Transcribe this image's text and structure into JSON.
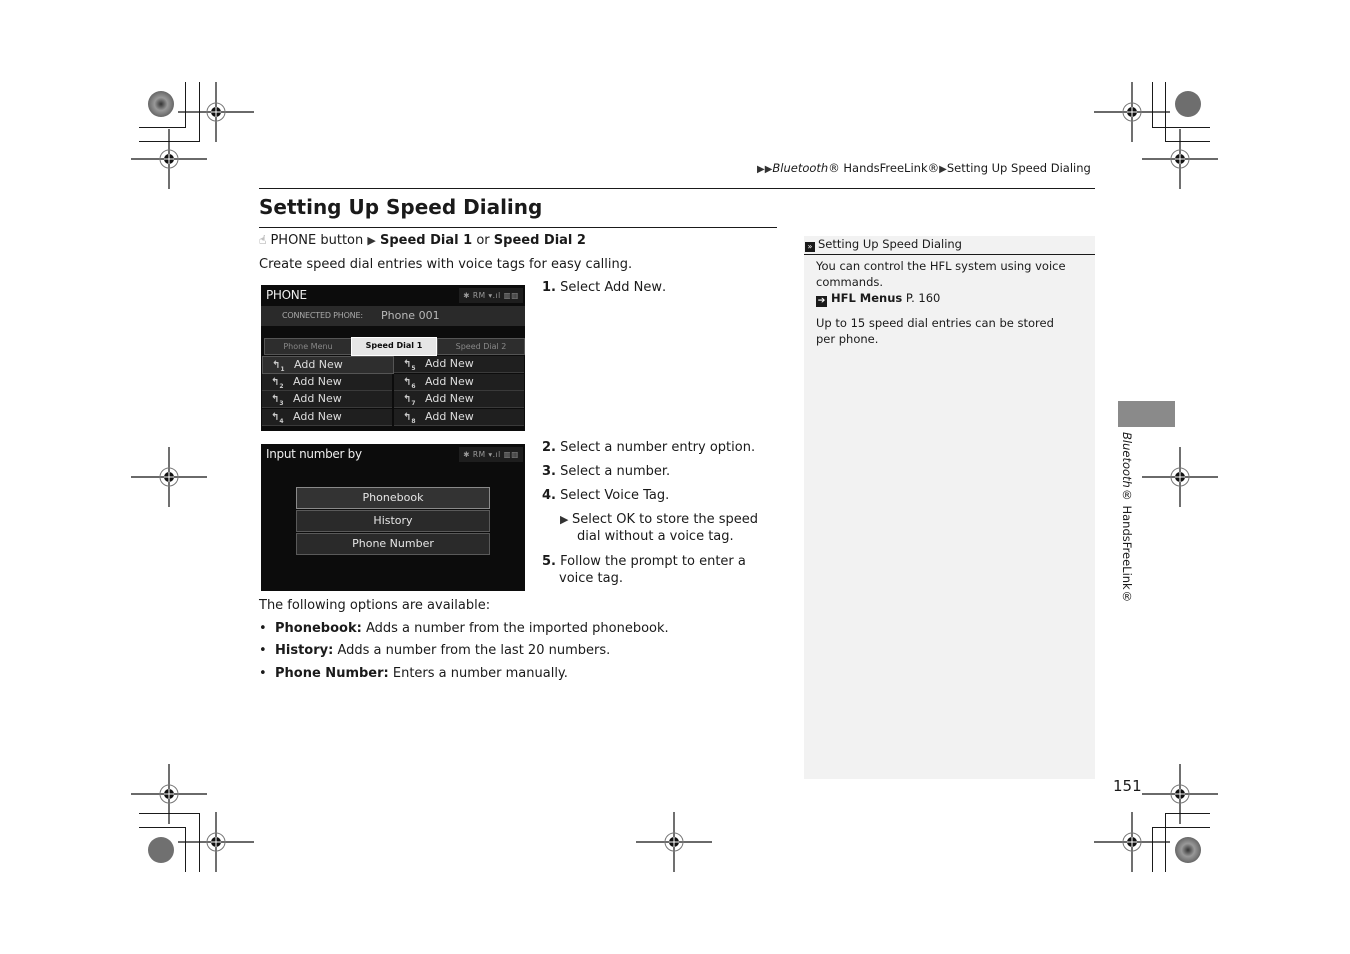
{
  "breadcrumb": {
    "items": [
      "Bluetooth",
      "® HandsFreeLink®",
      "Setting Up Speed Dialing"
    ],
    "separator_icon": "triangle-right-icon"
  },
  "title": "Setting Up Speed Dialing",
  "nav_path": {
    "icon": "hand-touch-icon",
    "start": "PHONE button",
    "option1": "Speed Dial 1",
    "or": "or",
    "option2": "Speed Dial 2"
  },
  "intro": "Create speed dial entries with voice tags for easy calling.",
  "screen1": {
    "title": "PHONE",
    "status": "✱ RM ▾.ıl ▥▥",
    "connected_label": "CONNECTED PHONE:",
    "connected_value": "Phone 001",
    "tabs": [
      {
        "label": "Phone Menu",
        "active": false
      },
      {
        "label": "Speed Dial 1",
        "active": true
      },
      {
        "label": "Speed Dial 2",
        "active": false
      }
    ],
    "entries": [
      {
        "slot": "1",
        "label": "Add New"
      },
      {
        "slot": "2",
        "label": "Add New"
      },
      {
        "slot": "3",
        "label": "Add New"
      },
      {
        "slot": "4",
        "label": "Add New"
      },
      {
        "slot": "5",
        "label": "Add New"
      },
      {
        "slot": "6",
        "label": "Add New"
      },
      {
        "slot": "7",
        "label": "Add New"
      },
      {
        "slot": "8",
        "label": "Add New"
      }
    ]
  },
  "screen2": {
    "title": "Input number by",
    "status": "✱ RM ▾.ıl ▥▥",
    "options": [
      "Phonebook",
      "History",
      "Phone Number"
    ]
  },
  "steps": {
    "s1": {
      "num": "1.",
      "text": "Select ",
      "bold": "Add New",
      "end": "."
    },
    "s2": {
      "num": "2.",
      "text": "Select a number entry option."
    },
    "s3": {
      "num": "3.",
      "text": "Select a number."
    },
    "s4": {
      "num": "4.",
      "text": "Select ",
      "bold": "Voice Tag",
      "end": "."
    },
    "s4_note": {
      "pre": "Select ",
      "bold": "OK",
      "post": " to store the speed dial without a voice tag."
    },
    "s5": {
      "num": "5.",
      "text": "Follow the prompt to enter a voice tag."
    }
  },
  "options": {
    "intro": "The following options are available:",
    "items": [
      {
        "name": "Phonebook:",
        "desc": " Adds a number from the imported phonebook."
      },
      {
        "name": "History:",
        "desc": " Adds a number from the last 20 numbers."
      },
      {
        "name": "Phone Number:",
        "desc": " Enters a number manually."
      }
    ]
  },
  "sidebar": {
    "header": "Setting Up Speed Dialing",
    "para1": "You can control the HFL system using voice commands.",
    "link_label": "HFL Menus",
    "link_page": " P. 160",
    "para2": "Up to 15 speed dial entries can be stored per phone."
  },
  "chapter": {
    "italic": "Bluetooth",
    "rest": "® HandsFreeLink®"
  },
  "page_number": "151",
  "colors": {
    "chapter_tab": "#8a8a8a",
    "sidebar_bg": "#f2f2f2",
    "screen_bg": "#0c0c0c"
  }
}
